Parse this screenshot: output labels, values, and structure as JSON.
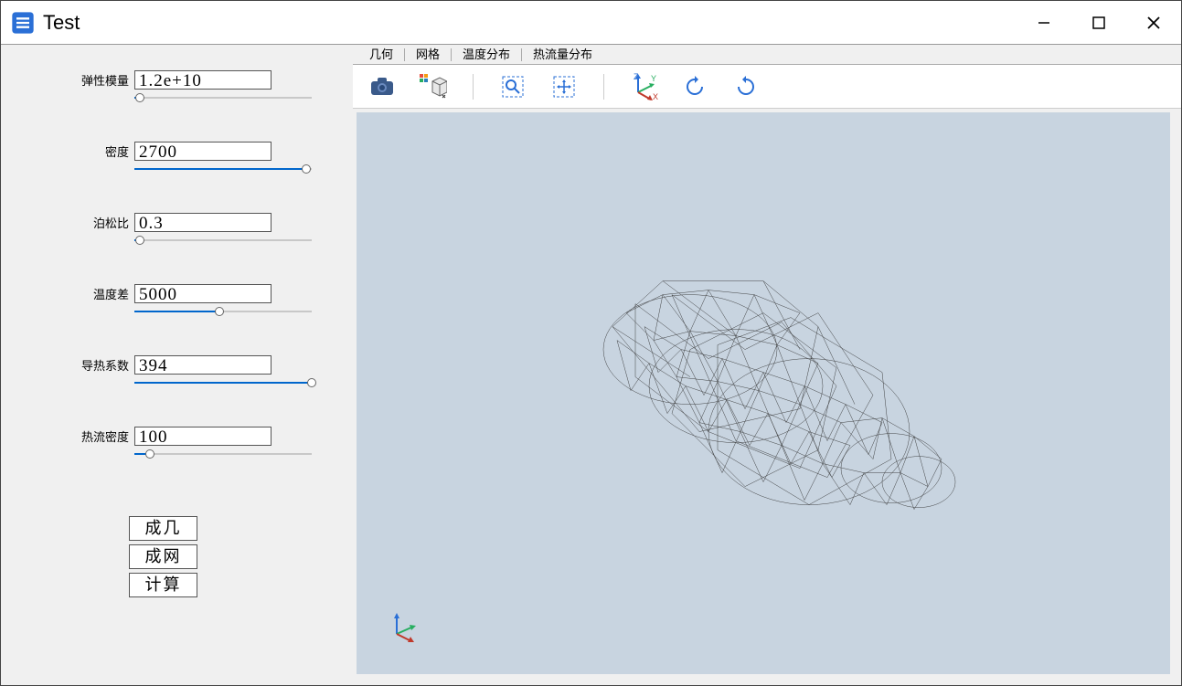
{
  "window": {
    "title": "Test"
  },
  "params": [
    {
      "label": "弹性模量",
      "value": "1.2e+10",
      "slider_pct": 3
    },
    {
      "label": "密度",
      "value": "2700",
      "slider_pct": 97
    },
    {
      "label": "泊松比",
      "value": "0.3",
      "slider_pct": 3
    },
    {
      "label": "温度差",
      "value": "5000",
      "slider_pct": 48
    },
    {
      "label": "导热系数",
      "value": "394",
      "slider_pct": 100
    },
    {
      "label": "热流密度",
      "value": "100",
      "slider_pct": 9
    }
  ],
  "buttons": {
    "geom": "成几",
    "mesh": "成网",
    "calc": "计算"
  },
  "tabs": [
    "几何",
    "网格",
    "温度分布",
    "热流量分布"
  ],
  "active_tab": 1,
  "toolbar_icons": [
    "camera",
    "cube-colors",
    "zoom-box",
    "pan",
    "axes",
    "rotate-cw",
    "rotate-ccw"
  ],
  "viewport": {
    "bg": "#c8d4e0",
    "content": "mesh-wireframe"
  }
}
